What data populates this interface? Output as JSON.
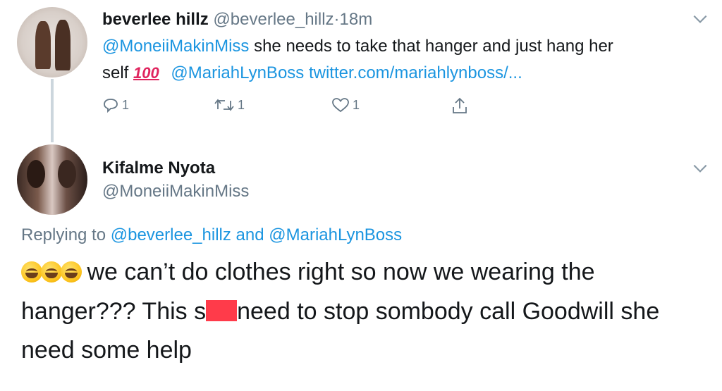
{
  "tweet1": {
    "display_name": "beverlee hillz",
    "handle": "@beverlee_hillz",
    "separator": "·",
    "time": "18m",
    "mention": "@MoneiiMakinMiss",
    "text_a": " she needs to take that hanger and just hang her",
    "text_b": "self ",
    "hundred_emoji": "100",
    "mention2": "@MariahLynBoss",
    "link": "twitter.com/mariahlynboss/...",
    "reply_count": "1",
    "retweet_count": "1",
    "like_count": "1",
    "icons": [
      "reply-icon",
      "retweet-icon",
      "like-icon",
      "share-icon",
      "chevron-down-icon"
    ]
  },
  "tweet2": {
    "display_name": "Kifalme Nyota",
    "handle": "@MoneiiMakinMiss",
    "replying_prefix": "Replying to ",
    "replying_user1": "@beverlee_hillz",
    "replying_and": " and ",
    "replying_user2": "@MariahLynBoss",
    "line1": " we can’t do clothes right so now we wearing the",
    "line2_a": "hanger??? This s",
    "line2_b": "need to stop sombody call Goodwill she",
    "line3": "need some help",
    "emojis": [
      "rolling-on-floor-laughing-emoji",
      "rolling-on-floor-laughing-emoji",
      "rolling-on-floor-laughing-emoji"
    ]
  },
  "colors": {
    "link_blue": "#1b95e0",
    "muted_gray": "#657786",
    "redaction_red": "#ff3b4a",
    "thread_line": "#ccd6dd"
  }
}
